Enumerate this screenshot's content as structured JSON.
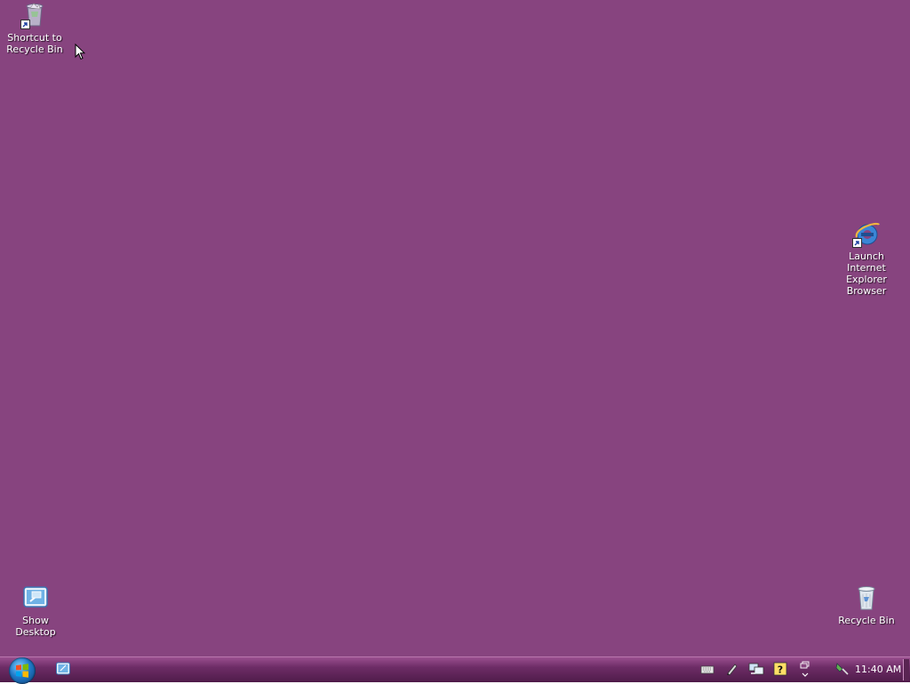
{
  "desktop": {
    "background_color": "#87447f",
    "icons": [
      {
        "name": "shortcut-to-recycle-bin",
        "label": "Shortcut to\nRecycle Bin",
        "icon": "recycle-bin-full-icon",
        "shortcut": true
      },
      {
        "name": "launch-internet-explorer",
        "label": "Launch\nInternet\nExplorer\nBrowser",
        "icon": "internet-explorer-icon",
        "shortcut": true
      },
      {
        "name": "show-desktop",
        "label": "Show\nDesktop",
        "icon": "show-desktop-icon",
        "shortcut": false
      },
      {
        "name": "recycle-bin",
        "label": "Recycle Bin",
        "icon": "recycle-bin-empty-icon",
        "shortcut": false
      }
    ]
  },
  "taskbar": {
    "start_button": "start-orb-icon",
    "quick_launch": [
      "show-desktop-icon"
    ],
    "tray_icons": [
      "keyboard-icon",
      "pen-icon",
      "network-icon",
      "help-icon",
      "restore-icon",
      "safely-remove-icon"
    ],
    "clock": "11:40 AM"
  }
}
